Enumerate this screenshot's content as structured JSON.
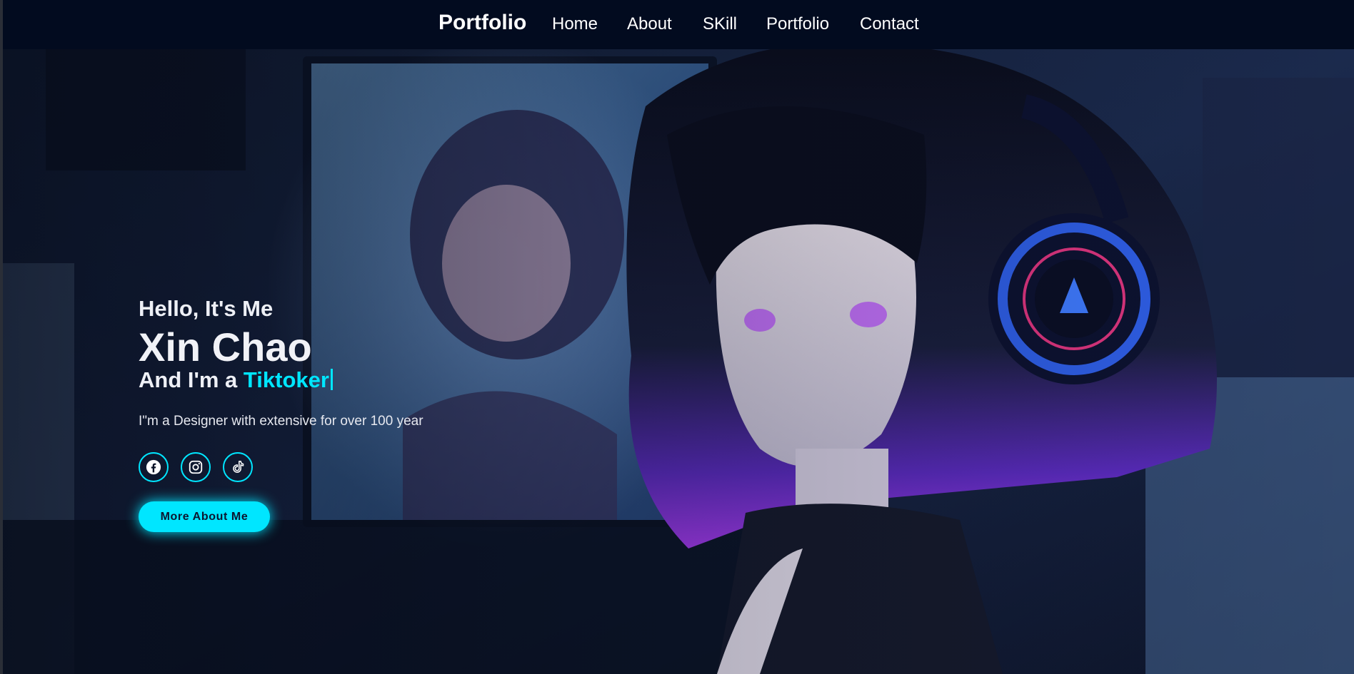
{
  "nav": {
    "logo": "Portfolio",
    "links": [
      "Home",
      "About",
      "SKill",
      "Portfolio",
      "Contact"
    ]
  },
  "hero": {
    "greeting": "Hello, It's Me",
    "name": "Xin Chao",
    "role_prefix": "And I'm a ",
    "role_highlight": "Tiktoker",
    "description": "I\"m a Designer with extensive for over 100 year",
    "socials": [
      "facebook-icon",
      "instagram-icon",
      "tiktok-icon"
    ],
    "cta_label": "More About Me"
  },
  "colors": {
    "accent": "#00e6ff",
    "nav_background": "#020b1f",
    "text": "#ffffff"
  }
}
